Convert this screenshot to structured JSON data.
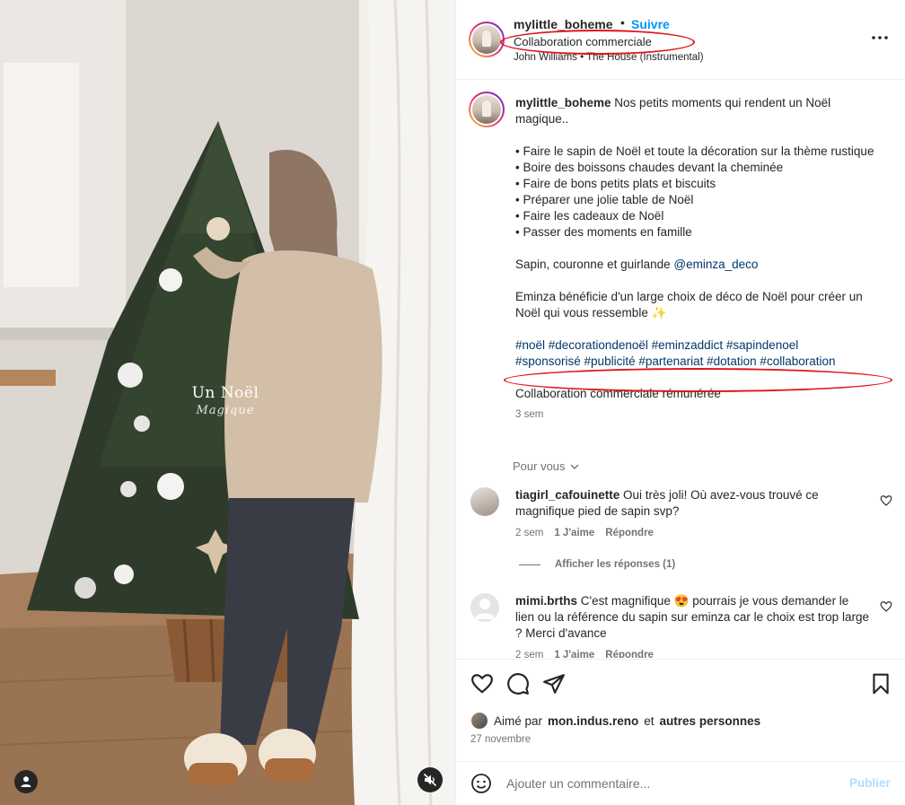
{
  "media": {
    "overlay_title": "Un Noël",
    "overlay_subtitle": "Magique",
    "user_icon": "person-icon",
    "mute_icon": "speaker-muted-icon"
  },
  "header": {
    "username": "mylittle_boheme",
    "separator": "•",
    "follow_label": "Suivre",
    "collab_label": "Collaboration commerciale",
    "audio": "John Williams • The House (Instrumental)",
    "more_icon": "more-options-icon"
  },
  "caption": {
    "username": "mylittle_boheme",
    "intro": "Nos petits moments qui rendent un Noël magique..",
    "bullets": [
      "• Faire le sapin de Noël et toute la décoration sur la thème rustique",
      "• Boire des boissons chaudes devant la cheminée",
      "• Faire de bons petits plats et biscuits",
      "• Préparer une jolie table de Noël",
      "• Faire les cadeaux de Noël",
      "• Passer des moments en famille"
    ],
    "products_text": "Sapin, couronne et guirlande",
    "products_mention": "@eminza_deco",
    "brand_text": "Eminza bénéficie d'un large choix de déco de Noël pour créer un Noël qui vous ressemble ✨",
    "hashtags_line1": "#noël #decorationdenoël #eminzaddict #sapindenoel",
    "hashtags_line2": "#sponsorisé #publicité #partenariat #dotation #collaboration",
    "paid_label": "Collaboration commerciale rémunérée",
    "time": "3 sem"
  },
  "for_you": "Pour vous",
  "comments": [
    {
      "username": "tiagirl_cafouinette",
      "text": "Oui très joli! Où avez-vous trouvé ce magnifique pied de sapin svp?",
      "time": "2 sem",
      "likes": "1 J'aime",
      "reply": "Répondre"
    },
    {
      "username": "mimi.brths",
      "text": "C'est magnifique 😍 pourrais je vous demander le lien ou la référence du sapin sur eminza car le choix est trop large ? Merci d'avance",
      "time": "2 sem",
      "likes": "1 J'aime",
      "reply": "Répondre"
    }
  ],
  "view_replies": "Afficher les réponses (1)",
  "actions": {
    "like_icon": "heart-icon",
    "comment_icon": "comment-icon",
    "share_icon": "send-icon",
    "save_icon": "bookmark-icon",
    "liked_prefix": "Aimé par",
    "liked_user": "mon.indus.reno",
    "liked_conj": "et",
    "liked_others": "autres personnes",
    "date": "27 novembre"
  },
  "add_comment": {
    "placeholder": "Ajouter un commentaire...",
    "publish_label": "Publier",
    "emoji_icon": "smiley-icon"
  },
  "colors": {
    "link": "#00376b",
    "follow": "#0095f6",
    "annotation": "#e0151c",
    "muted": "#737373"
  }
}
